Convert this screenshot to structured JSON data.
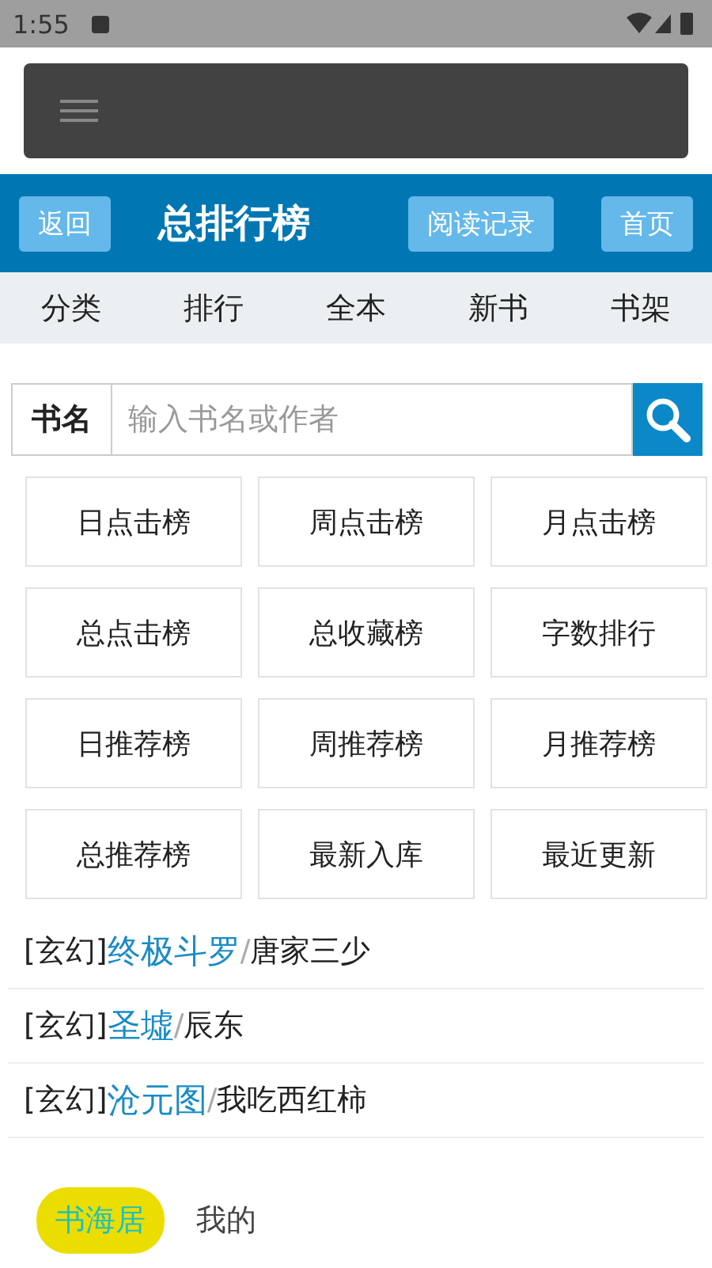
{
  "status_bar": {
    "time": "1:55"
  },
  "header": {
    "back": "返回",
    "title": "总排行榜",
    "history": "阅读记录",
    "home": "首页"
  },
  "nav": [
    "分类",
    "排行",
    "全本",
    "新书",
    "书架"
  ],
  "search": {
    "label": "书名",
    "placeholder": "输入书名或作者"
  },
  "rankings": [
    "日点击榜",
    "周点击榜",
    "月点击榜",
    "总点击榜",
    "总收藏榜",
    "字数排行",
    "日推荐榜",
    "周推荐榜",
    "月推荐榜",
    "总推荐榜",
    "最新入库",
    "最近更新"
  ],
  "books": [
    {
      "genre": "[玄幻]",
      "title": "终极斗罗",
      "separator": "/",
      "author": "唐家三少"
    },
    {
      "genre": "[玄幻]",
      "title": "圣墟",
      "separator": "/",
      "author": "辰东"
    },
    {
      "genre": "[玄幻]",
      "title": "沧元图",
      "separator": "/",
      "author": "我吃西红柿"
    }
  ],
  "bottom_tabs": [
    {
      "label": "书海居",
      "selected": true
    },
    {
      "label": "我的",
      "selected": false
    }
  ]
}
